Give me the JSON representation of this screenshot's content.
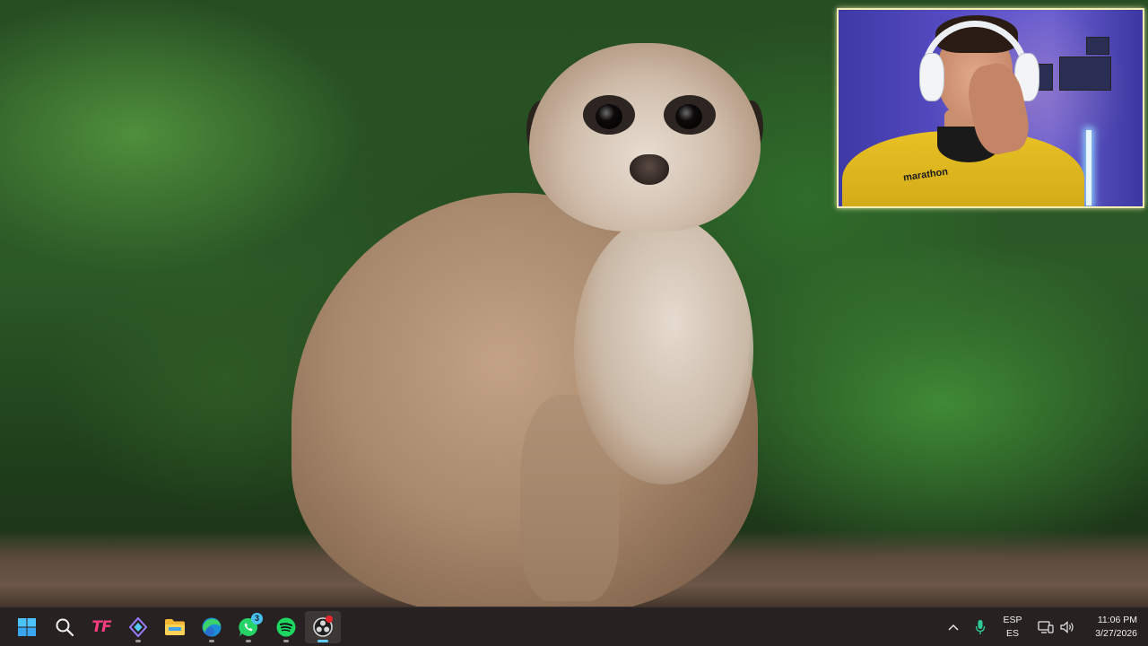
{
  "wallpaper": {
    "subject_icon": "meerkat-photo",
    "background_color": "#2c5a27"
  },
  "webcam": {
    "shirt_logo": "marathon",
    "accent": "#f4efb0"
  },
  "taskbar": {
    "apps": [
      {
        "name": "start-button",
        "icon": "windows-logo-icon"
      },
      {
        "name": "search-button",
        "icon": "search-icon"
      },
      {
        "name": "tf-app",
        "icon": "tf-logo-icon",
        "label": "TF"
      },
      {
        "name": "app-diamond",
        "icon": "diamond-icon"
      },
      {
        "name": "file-explorer",
        "icon": "folder-icon"
      },
      {
        "name": "edge-browser",
        "icon": "edge-icon"
      },
      {
        "name": "whatsapp",
        "icon": "whatsapp-icon",
        "badge": "3"
      },
      {
        "name": "spotify",
        "icon": "spotify-icon"
      },
      {
        "name": "obs-studio",
        "icon": "obs-icon"
      }
    ],
    "tray": {
      "language_top": "ESP",
      "language_bottom": "ES",
      "time": "11:06 PM",
      "date": "3/27/2026"
    },
    "accent_color": "#60cdff"
  }
}
